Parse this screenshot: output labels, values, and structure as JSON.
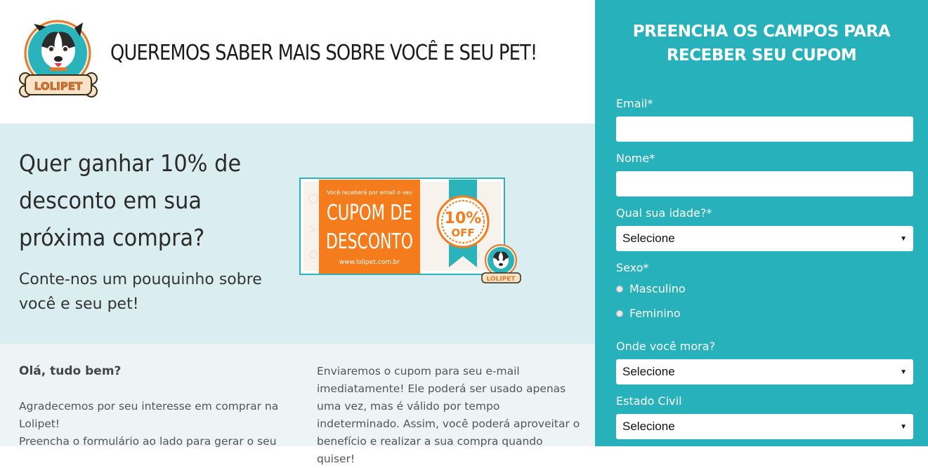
{
  "header": {
    "title": "QUEREMOS SABER MAIS SOBRE VOCÊ E SEU PET!",
    "logo_text": "LOLIPET"
  },
  "hero": {
    "title": "Quer ganhar 10% de desconto em sua próxima compra?",
    "subtitle": "Conte-nos um pouquinho sobre você e seu pet!",
    "coupon": {
      "small_text": "Você receberá por email o seu",
      "line1": "CUPOM DE",
      "line2": "DESCONTO",
      "url": "www.lolipet.com.br",
      "badge_pct": "10%",
      "badge_off": "OFF",
      "logo_text": "LOLIPET"
    }
  },
  "content": {
    "greeting": "Olá, tudo bem?",
    "col1_text": "Agradecemos por seu interesse em comprar na Lolipet!",
    "col1_text2": "Preencha o formulário ao lado para gerar o seu",
    "col2_text": "Enviaremos o cupom para seu e-mail imediatamente! Ele poderá ser usado apenas uma vez, mas é válido por tempo indeterminado. Assim, você poderá aproveitar o benefício e realizar a sua compra quando quiser!"
  },
  "form": {
    "title_line1": "PREENCHA OS CAMPOS PARA",
    "title_line2": "RECEBER SEU CUPOM",
    "email_label": "Email*",
    "email_value": "",
    "name_label": "Nome*",
    "name_value": "",
    "age_label": "Qual sua idade?*",
    "age_value": "Selecione",
    "sex_label": "Sexo*",
    "sex_options": [
      "Masculino",
      "Feminino"
    ],
    "city_label": "Onde você mora?",
    "city_value": "Selecione",
    "civil_label": "Estado Civil",
    "civil_value": "Selecione",
    "arrow": "▼"
  },
  "colors": {
    "panel": "#27b1ba",
    "hero_bg": "#daeef1",
    "content_bg": "#eef3f4",
    "coupon_orange": "#f47c1c",
    "coupon_teal": "#2ab3bb"
  }
}
